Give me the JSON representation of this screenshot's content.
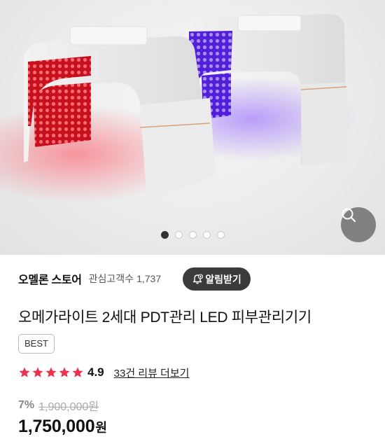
{
  "product_image": {
    "alt": "",
    "dots_count": 5,
    "active_index": 0
  },
  "store": {
    "name": "오멜론 스토어",
    "follower_label": "관심고객수",
    "follower_count": "1,737",
    "notify_label": "알림받기"
  },
  "product": {
    "title": "오메가라이트 2세대 PDT관리 LED 피부관리기기",
    "badge": "BEST"
  },
  "rating": {
    "stars": 5,
    "score": "4.9",
    "reviews_link": "33건 리뷰 더보기"
  },
  "pricing": {
    "discount": "7%",
    "original_price": "1,900,000원",
    "price": "1,750,000",
    "currency": "원"
  },
  "colors": {
    "star": "#e8344e",
    "notify_bg": "#3b3b3b",
    "red_led": "#ff2a3a",
    "purple_led": "#6a2cff"
  },
  "icons": {
    "zoom": "magnifier-icon",
    "notify": "bell-plus-icon",
    "star": "star-icon"
  }
}
